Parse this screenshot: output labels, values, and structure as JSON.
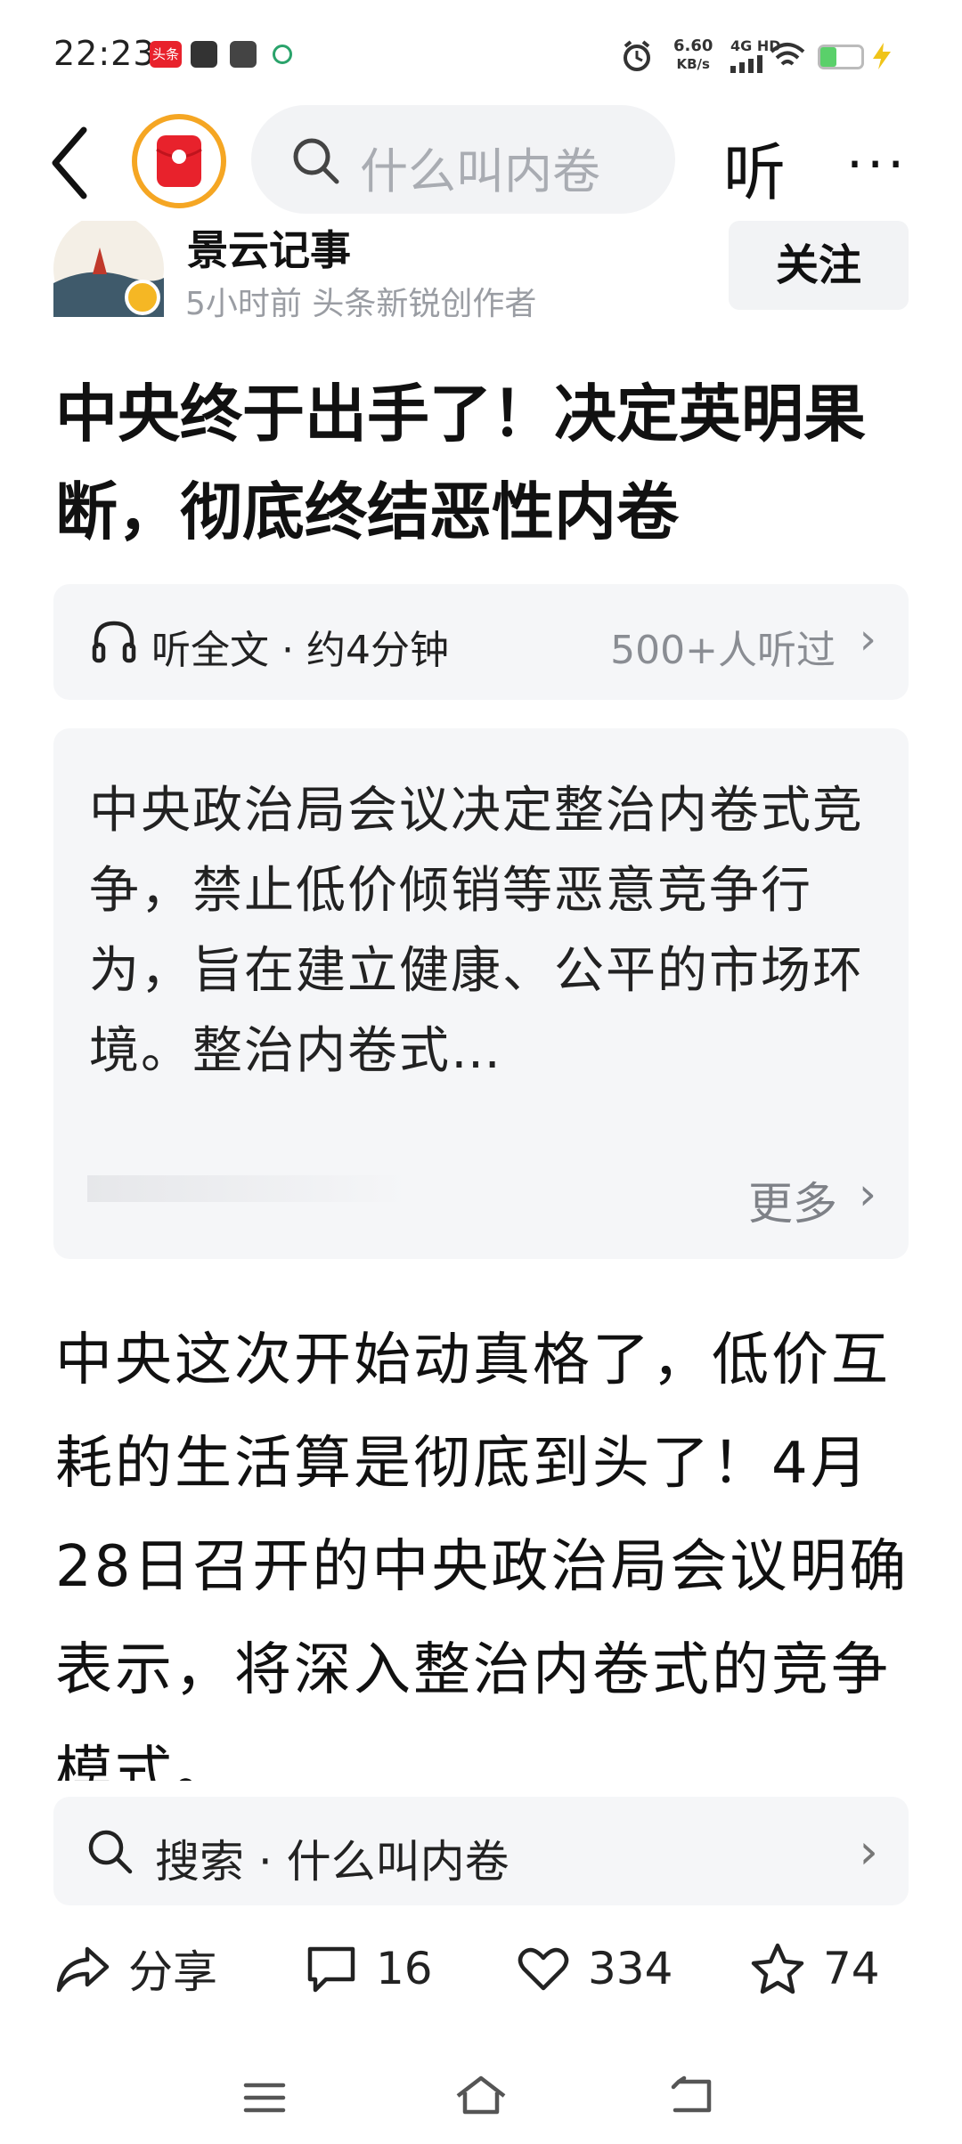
{
  "status_bar": {
    "time": "22:23",
    "app_badge": "头条",
    "net_speed_value": "6.60",
    "net_speed_unit": "KB/s",
    "net_type": "4G HD"
  },
  "nav": {
    "search_placeholder": "什么叫内卷",
    "listen_label": "听",
    "more_label": "···"
  },
  "author": {
    "name": "景云记事",
    "meta": "5小时前  头条新锐创作者",
    "follow_label": "关注"
  },
  "article": {
    "title": "中央终于出手了！决定英明果断，彻底终结恶性内卷",
    "listen_bar": {
      "label": "听全文 · 约4分钟",
      "count": "500+人听过"
    },
    "summary": {
      "text": "中央政治局会议决定整治内卷式竞争，禁止低价倾销等恶意竞争行为，旨在建立健康、公平的市场环境。整治内卷式…",
      "more_label": "更多"
    },
    "body": "中央这次开始动真格了，低价互耗的生活算是彻底到头了！4月28日召开的中央政治局会议明确表示，将深入整治内卷式的竞争模式。"
  },
  "search_suggestion": {
    "text": "搜索 · 什么叫内卷"
  },
  "actions": {
    "share_label": "分享",
    "comment_count": "16",
    "like_count": "334",
    "favorite_count": "74"
  },
  "colors": {
    "accent_orange": "#f5a623",
    "brand_red": "#e8222c",
    "card_bg": "#f5f6f8"
  }
}
